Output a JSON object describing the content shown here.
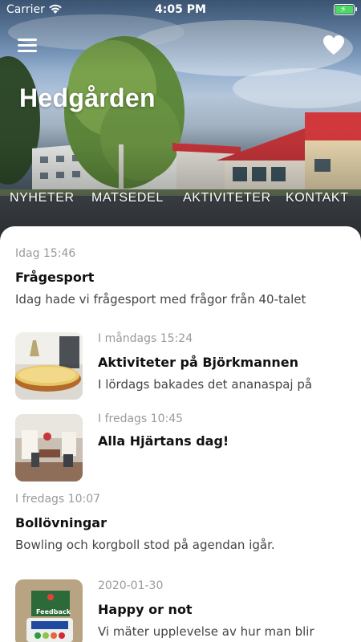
{
  "status_bar": {
    "carrier": "Carrier",
    "time": "4:05 PM"
  },
  "header": {
    "title": "Hedgården",
    "tabs": [
      "NYHETER",
      "MATSEDEL",
      "AKTIVITETER",
      "KONTAKT"
    ]
  },
  "news": [
    {
      "date": "Idag 15:46",
      "title": "Frågesport",
      "text": "Idag hade vi frågesport med frågor från 40-talet"
    },
    {
      "date": "I måndags 15:24",
      "title": "Aktiviteter på Björkmannen",
      "text": "I lördags bakades det ananaspaj på"
    },
    {
      "date": "I fredags 10:45",
      "title": "Alla Hjärtans dag!",
      "text": ""
    },
    {
      "date": "I fredags 10:07",
      "title": "Bollövningar",
      "text": "Bowling och korgboll stod på agendan igår."
    },
    {
      "date": "2020-01-30",
      "title": "Happy or not",
      "text": "Vi mäter upplevelse av hur man blir"
    }
  ],
  "thumbnails": {
    "feedback_sign": "Feedback"
  },
  "colors": {
    "battery": "#4cd964",
    "text": "#111111",
    "muted": "#9a9a9a"
  }
}
